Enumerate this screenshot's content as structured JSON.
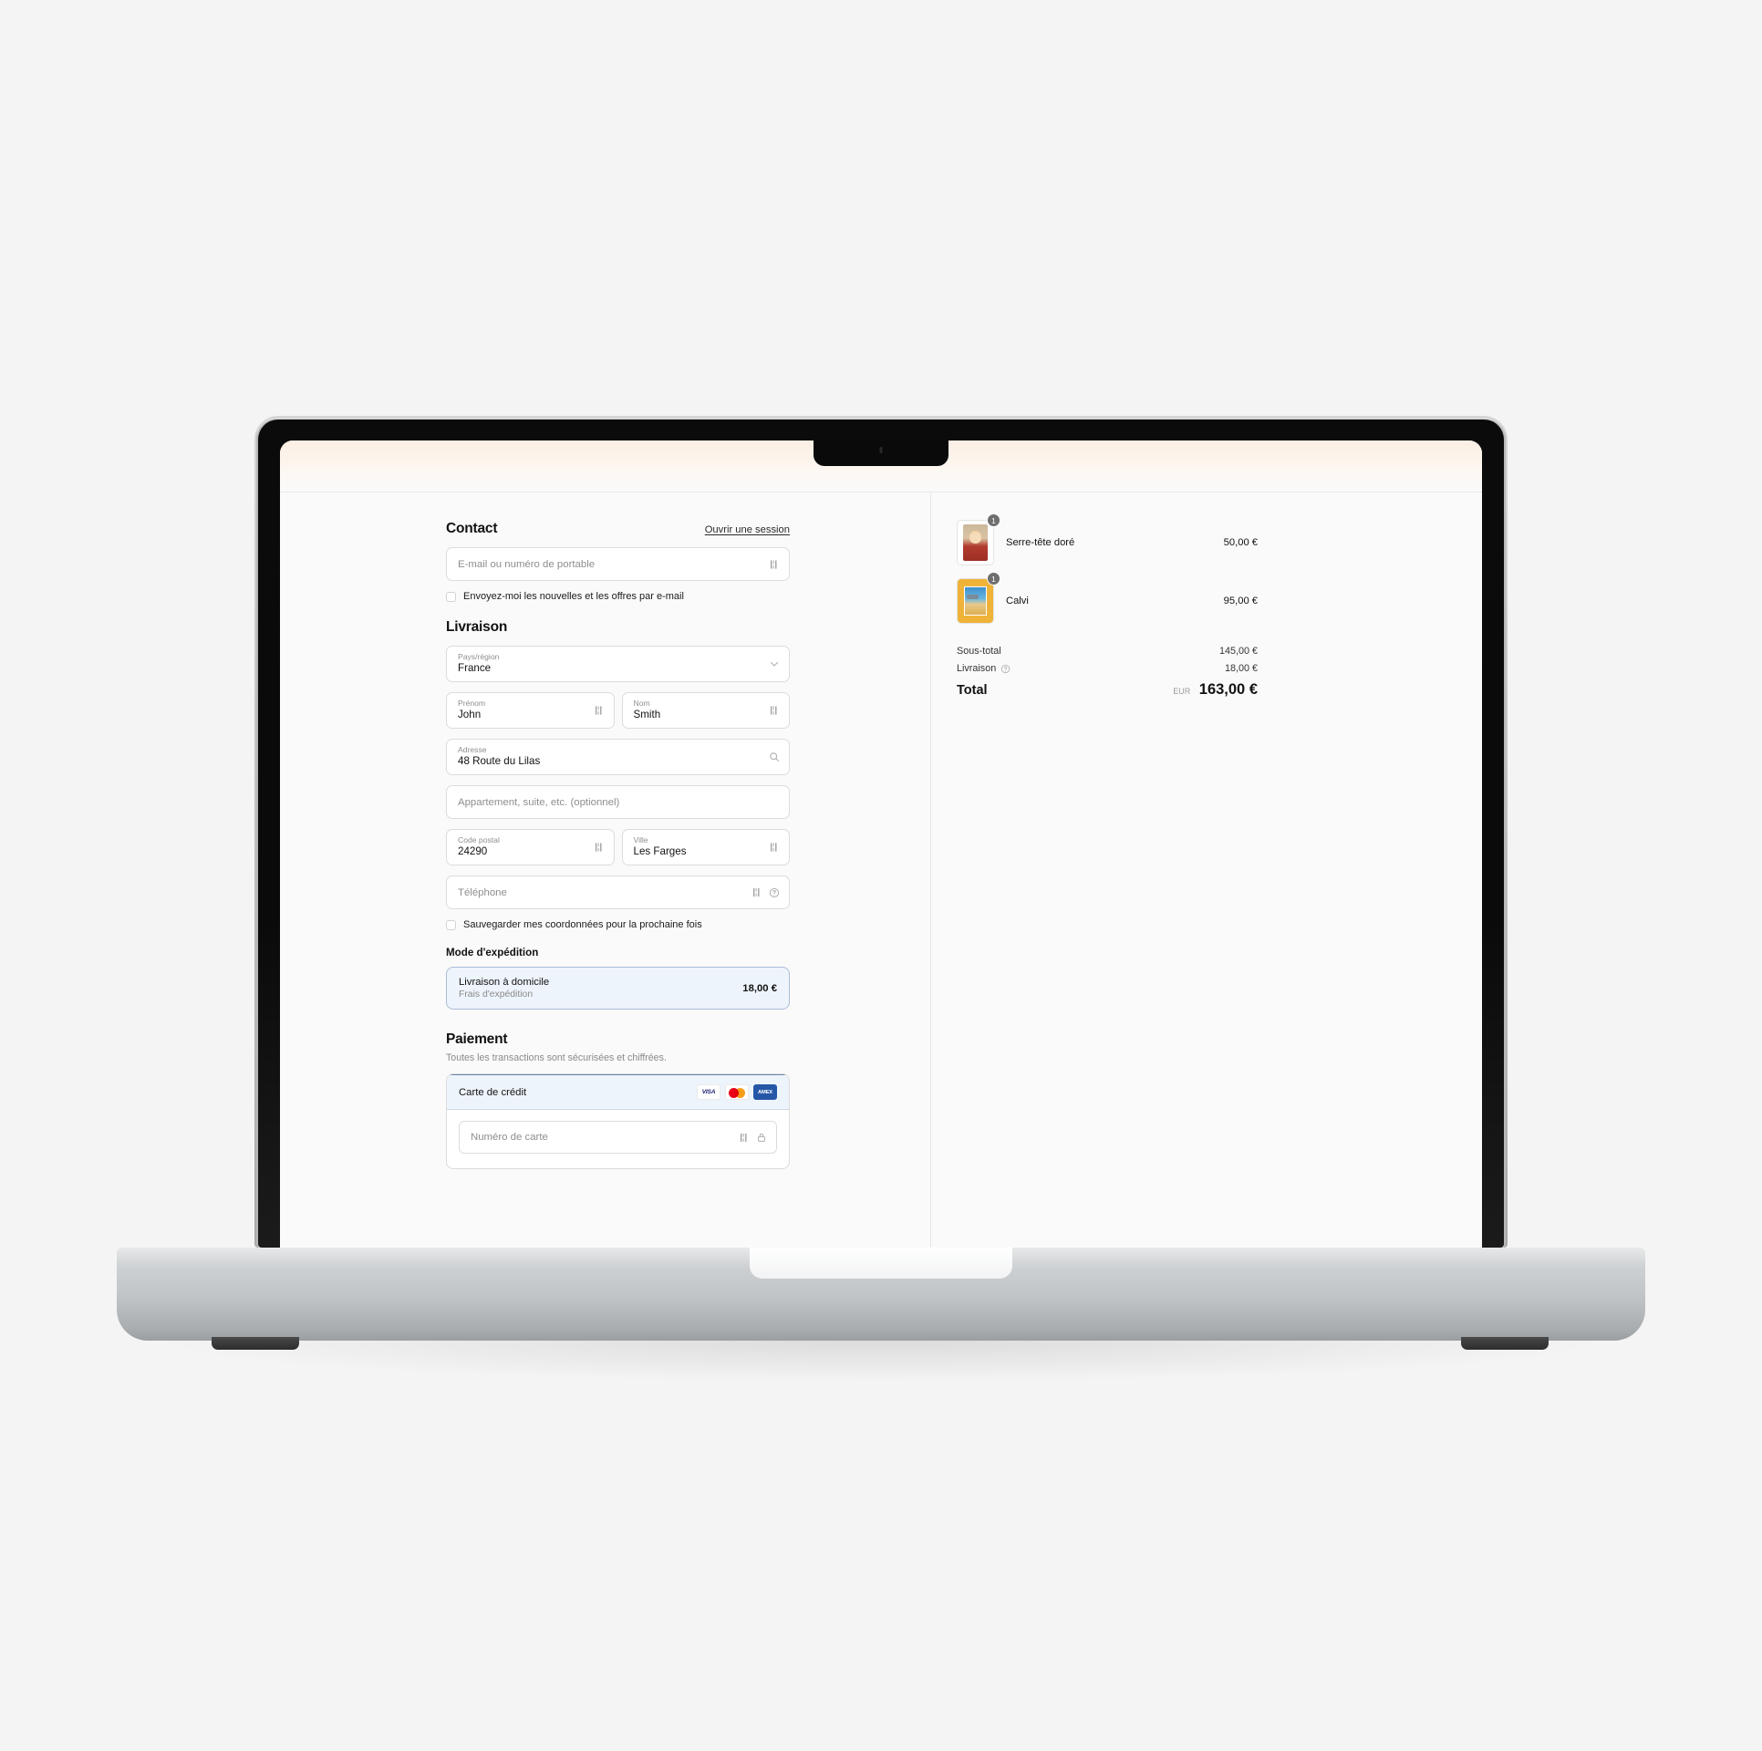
{
  "contact": {
    "heading": "Contact",
    "login_link": "Ouvrir une session",
    "email_placeholder": "E-mail ou numéro de portable",
    "newsletter_label": "Envoyez-moi les nouvelles et les offres par e-mail"
  },
  "delivery": {
    "heading": "Livraison",
    "country_label": "Pays/région",
    "country_value": "France",
    "firstname_label": "Prénom",
    "firstname_value": "John",
    "lastname_label": "Nom",
    "lastname_value": "Smith",
    "address_label": "Adresse",
    "address_value": "48 Route du Lilas",
    "apartment_placeholder": "Appartement, suite, etc. (optionnel)",
    "postal_label": "Code postal",
    "postal_value": "24290",
    "city_label": "Ville",
    "city_value": "Les Farges",
    "phone_placeholder": "Téléphone",
    "save_info_label": "Sauvegarder mes coordonnées pour la prochaine fois",
    "shipping_method_heading": "Mode d'expédition",
    "shipping_option_title": "Livraison à domicile",
    "shipping_option_subtitle": "Frais d'expédition",
    "shipping_option_price": "18,00 €"
  },
  "payment": {
    "heading": "Paiement",
    "note": "Toutes les transactions sont sécurisées et chiffrées.",
    "method_title": "Carte de crédit",
    "brands": [
      "VISA",
      "mastercard",
      "AMEX"
    ],
    "visa_label": "VISA",
    "amex_label": "AMEX",
    "card_number_placeholder": "Numéro de carte"
  },
  "summary": {
    "items": [
      {
        "name": "Serre-tête doré",
        "qty": "1",
        "price": "50,00 €"
      },
      {
        "name": "Calvi",
        "qty": "1",
        "price": "95,00 €"
      }
    ],
    "subtotal_label": "Sous-total",
    "subtotal_value": "145,00 €",
    "shipping_label": "Livraison",
    "shipping_value": "18,00 €",
    "total_label": "Total",
    "total_currency": "EUR",
    "total_value": "163,00 €"
  },
  "colors": {
    "accent_selected_bg": "#eef4fb",
    "accent_selected_border": "#a9bdd8",
    "page_bg": "#fafafa",
    "visa_blue": "#1a1f71",
    "amex_blue": "#2557a7",
    "mc_red": "#eb001b",
    "mc_orange": "#f79e1b"
  }
}
